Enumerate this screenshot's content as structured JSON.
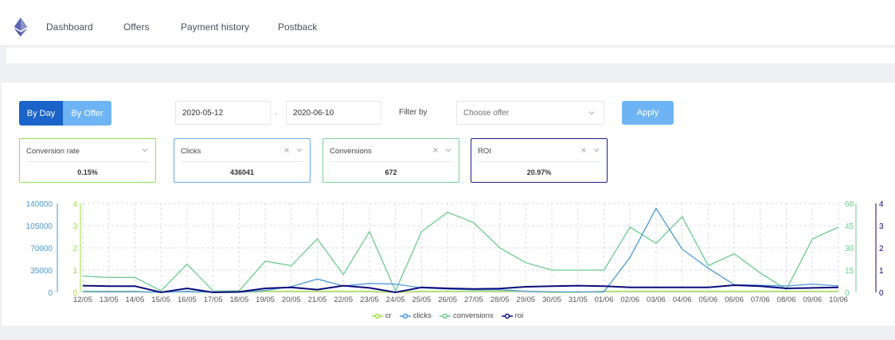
{
  "nav": {
    "items": [
      "Dashboard",
      "Offers",
      "Payment history",
      "Postback"
    ]
  },
  "controls": {
    "by_day": "By Day",
    "by_offer": "By Offer",
    "date_from": "2020-05-12",
    "date_to": "2020-06-10",
    "date_sep": "-",
    "filter_label": "Filter by",
    "offer_placeholder": "Choose offer",
    "apply": "Apply"
  },
  "cards": [
    {
      "title": "Conversion rate",
      "value": "0.15%",
      "color": "#8fe04a",
      "closable": false
    },
    {
      "title": "Clicks",
      "value": "436041",
      "color": "#6aa8e0",
      "closable": true
    },
    {
      "title": "Conversions",
      "value": "672",
      "color": "#7dcf9a",
      "closable": true
    },
    {
      "title": "ROI",
      "value": "20.97%",
      "color": "#1a1a8c",
      "closable": true
    }
  ],
  "colors": {
    "cr": "#9be03a",
    "clicks": "#4a98d8",
    "conversions": "#6ccb8e",
    "roi": "#0b0b7a",
    "grid": "#d9dbe0"
  },
  "chart_data": {
    "type": "line",
    "x": [
      "12/05",
      "13/05",
      "14/05",
      "15/05",
      "16/05",
      "17/05",
      "18/05",
      "19/05",
      "20/05",
      "21/05",
      "22/05",
      "23/05",
      "24/05",
      "25/05",
      "26/05",
      "27/05",
      "28/05",
      "29/05",
      "30/05",
      "31/05",
      "01/06",
      "02/06",
      "03/06",
      "04/06",
      "05/06",
      "06/06",
      "07/06",
      "08/06",
      "09/06",
      "10/06"
    ],
    "axes": {
      "clicks": {
        "ticks": [
          "0",
          "35000",
          "70000",
          "105000",
          "140000"
        ],
        "range": [
          0,
          140000
        ]
      },
      "cr": {
        "ticks": [
          "0",
          "1",
          "2",
          "3",
          "4"
        ],
        "range": [
          0,
          4
        ]
      },
      "conversions": {
        "ticks": [
          "0",
          "15",
          "30",
          "45",
          "60"
        ],
        "range": [
          0,
          60
        ]
      },
      "roi": {
        "ticks": [
          "0",
          "1",
          "2",
          "3",
          "4"
        ],
        "range": [
          0,
          4
        ]
      }
    },
    "series": [
      {
        "name": "cr",
        "axis": "cr",
        "values": [
          0.05,
          0.05,
          0.05,
          0.0,
          0.05,
          0.0,
          0.0,
          0.05,
          0.05,
          0.05,
          0.05,
          0.05,
          0.0,
          0.05,
          0.05,
          0.05,
          0.05,
          0.05,
          0.0,
          0.0,
          0.05,
          0.05,
          0.05,
          0.05,
          0.05,
          0.05,
          0.05,
          0.05,
          0.05,
          0.05
        ]
      },
      {
        "name": "clicks",
        "axis": "clicks",
        "values": [
          1200,
          1000,
          1200,
          0,
          1500,
          0,
          0,
          3000,
          9000,
          21000,
          10000,
          14000,
          13000,
          7000,
          5000,
          4000,
          4000,
          1800,
          800,
          600,
          900,
          55000,
          132000,
          68000,
          38000,
          12000,
          11000,
          10000,
          13000,
          10000
        ]
      },
      {
        "name": "conversions",
        "axis": "conversions",
        "values": [
          11,
          10,
          10,
          1,
          19,
          1,
          1,
          21,
          18,
          36,
          12,
          41,
          1,
          41,
          54,
          47,
          30,
          20,
          15,
          15,
          15,
          44,
          33,
          51,
          18,
          26,
          13,
          2,
          36,
          44
        ]
      },
      {
        "name": "roi",
        "axis": "roi",
        "values": [
          0.3,
          0.28,
          0.28,
          0.0,
          0.18,
          0.0,
          0.02,
          0.18,
          0.22,
          0.12,
          0.3,
          0.2,
          0.0,
          0.22,
          0.18,
          0.15,
          0.17,
          0.25,
          0.28,
          0.3,
          0.28,
          0.22,
          0.22,
          0.22,
          0.22,
          0.32,
          0.28,
          0.18,
          0.2,
          0.22
        ]
      }
    ],
    "legend": [
      "cr",
      "clicks",
      "conversions",
      "roi"
    ],
    "legend_position": "bottom",
    "grid": true
  }
}
